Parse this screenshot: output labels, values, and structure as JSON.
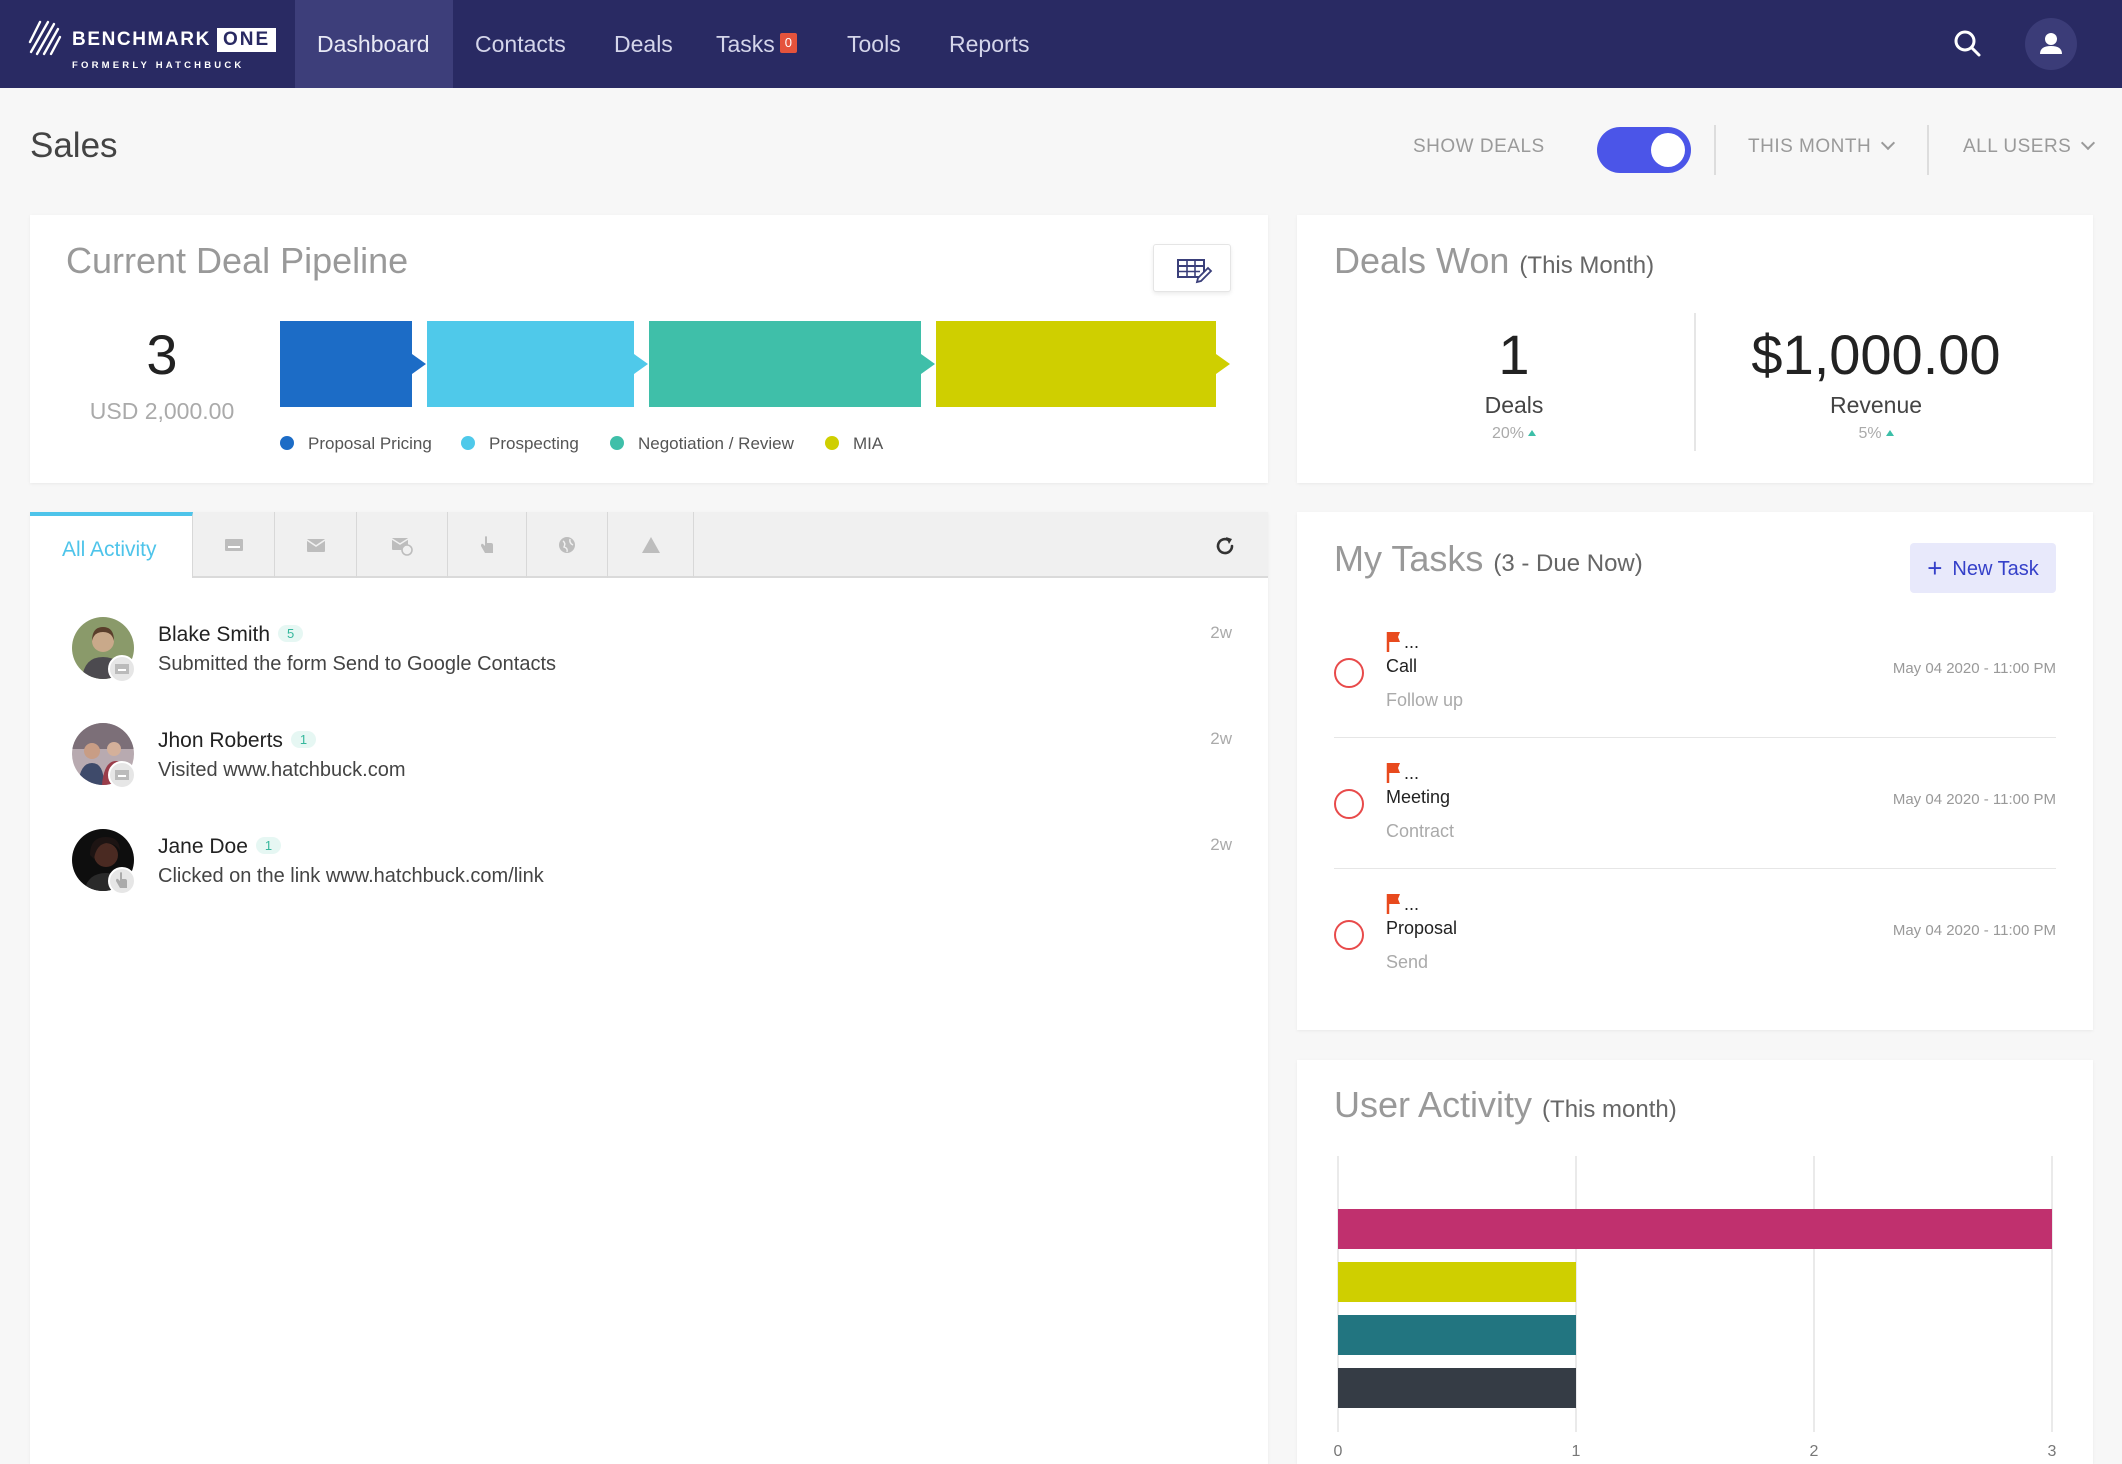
{
  "nav": {
    "logo_main": "BENCHMARK",
    "logo_box": "ONE",
    "logo_sub": "FORMERLY HATCHBUCK",
    "items": [
      {
        "label": "Dashboard",
        "active": true
      },
      {
        "label": "Contacts",
        "active": false
      },
      {
        "label": "Deals",
        "active": false
      },
      {
        "label": "Tasks",
        "active": false,
        "badge": "0"
      },
      {
        "label": "Tools",
        "active": false
      },
      {
        "label": "Reports",
        "active": false
      }
    ],
    "icons": [
      "search-icon",
      "user-icon"
    ]
  },
  "header": {
    "title": "Sales",
    "show_deals_label": "SHOW DEALS",
    "show_deals_on": true,
    "period": "THIS MONTH",
    "users": "ALL USERS"
  },
  "pipeline": {
    "title": "Current Deal Pipeline",
    "count": "3",
    "amount": "USD 2,000.00",
    "edit_icon": "table-edit-icon",
    "stages": [
      {
        "name": "Proposal Pricing",
        "color": "#1c6cc6"
      },
      {
        "name": "Prospecting",
        "color": "#4fc9ea"
      },
      {
        "name": "Negotiation / Review",
        "color": "#3fbfa9"
      },
      {
        "name": "MIA",
        "color": "#cfcf00"
      }
    ]
  },
  "deals_won": {
    "title": "Deals Won",
    "subtitle": "(This Month)",
    "deals_value": "1",
    "deals_label": "Deals",
    "deals_pct": "20%",
    "revenue_value": "$1,000.00",
    "revenue_label": "Revenue",
    "revenue_pct": "5%"
  },
  "activity": {
    "active_tab": "All Activity",
    "tab_icons": [
      "form-icon",
      "email-icon",
      "email-opened-icon",
      "click-icon",
      "globe-icon",
      "alert-icon"
    ],
    "refresh_icon": "refresh-icon",
    "items": [
      {
        "name": "Blake Smith",
        "count": "5",
        "desc": "Submitted the form Send to Google Contacts",
        "time": "2w"
      },
      {
        "name": "Jhon Roberts",
        "count": "1",
        "desc": "Visited www.hatchbuck.com",
        "time": "2w"
      },
      {
        "name": "Jane Doe",
        "count": "1",
        "desc": "Clicked on the link www.hatchbuck.com/link",
        "time": "2w"
      }
    ]
  },
  "tasks": {
    "title": "My Tasks",
    "subtitle": "(3 - Due Now)",
    "new_task_label": "New Task",
    "items": [
      {
        "flag": "...",
        "type": "Call",
        "desc": "Follow up",
        "date": "May 04 2020 - 11:00 PM"
      },
      {
        "flag": "...",
        "type": "Meeting",
        "desc": "Contract",
        "date": "May 04 2020 - 11:00 PM"
      },
      {
        "flag": "...",
        "type": "Proposal",
        "desc": "Send",
        "date": "May 04 2020 - 11:00 PM"
      }
    ]
  },
  "user_activity": {
    "title": "User Activity",
    "subtitle": "(This month)"
  },
  "chart_data": {
    "type": "bar",
    "orientation": "horizontal",
    "series": [
      {
        "values": [
          3
        ],
        "color": "#c0306e"
      },
      {
        "values": [
          1
        ],
        "color": "#cfcf00"
      },
      {
        "values": [
          1
        ],
        "color": "#227580"
      },
      {
        "values": [
          1
        ],
        "color": "#353c45"
      }
    ],
    "xlim": [
      0,
      3
    ],
    "x_ticks": [
      "0",
      "1",
      "2",
      "3"
    ],
    "grid": true
  }
}
